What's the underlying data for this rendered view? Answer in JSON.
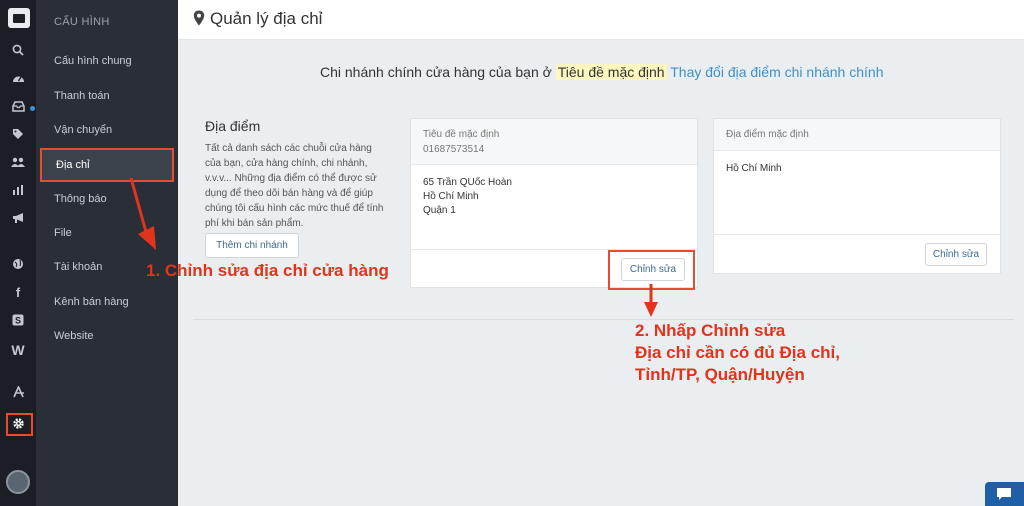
{
  "sidebar": {
    "heading": "CẤU HÌNH",
    "items": [
      {
        "label": "Cấu hình chung"
      },
      {
        "label": "Thanh toán"
      },
      {
        "label": "Vận chuyển"
      },
      {
        "label": "Địa chỉ"
      },
      {
        "label": "Thông báo"
      },
      {
        "label": "File"
      },
      {
        "label": "Tài khoản"
      },
      {
        "label": "Kênh bán hàng"
      },
      {
        "label": "Website"
      }
    ]
  },
  "header": {
    "title": "Quản lý địa chỉ"
  },
  "notice": {
    "prefix": "Chi nhánh chính cửa hàng của bạn ở",
    "highlight": "Tiêu đề mặc định",
    "link": "Thay đổi địa điểm chi nhánh chính"
  },
  "locations": {
    "title": "Địa điểm",
    "description": "Tất cả danh sách các chuỗi cửa hàng của bạn, cửa hàng chính, chi nhánh, v.v.v... Những địa điểm có thể được sử dụng để theo dõi bán hàng và để giúp chúng tôi cấu hình các mức thuế để tính phí khi bán sản phẩm.",
    "add_button": "Thêm chi nhánh"
  },
  "card_main": {
    "name": "Tiêu đề mặc định",
    "phone": "01687573514",
    "address_lines": [
      "65 Trần QUốc Hoàn",
      "Hồ Chí Minh",
      "Quận 1"
    ],
    "edit_button": "Chỉnh sửa"
  },
  "card_second": {
    "header": "Địa điểm mặc định",
    "address_line": "Hồ Chí Minh",
    "edit_button": "Chỉnh sửa"
  },
  "annotations": {
    "step1": "1. Chỉnh sửa địa chỉ cửa hàng",
    "step2_lines": [
      "2. Nhấp Chỉnh sửa",
      "Địa chỉ cần có đủ Địa chỉ,",
      "Tỉnh/TP, Quận/Huyện"
    ]
  },
  "colors": {
    "rail": "#1b1e24",
    "menu": "#2a2f37",
    "annotation_red": "#e0341c",
    "link_blue": "#3d91c9",
    "highlight_yellow": "#fdf6bf"
  },
  "icons": [
    "logo-icon",
    "search-icon",
    "dashboard-icon",
    "inbox-icon",
    "tag-icon",
    "users-icon",
    "bar-chart-icon",
    "megaphone-icon",
    "globe-icon",
    "facebook-icon",
    "s-store-icon",
    "w-icon",
    "app-store-icon",
    "gear-icon",
    "avatar",
    "map-pin-icon",
    "chat-icon"
  ]
}
